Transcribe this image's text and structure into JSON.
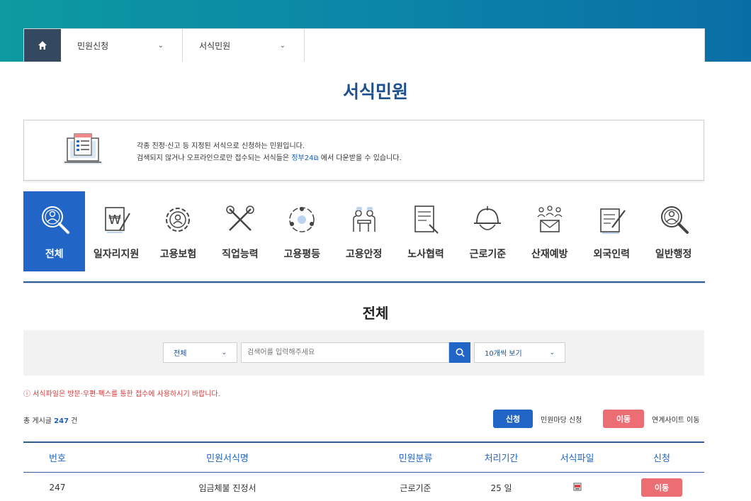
{
  "nav": {
    "home_icon": "home-icon",
    "menu1": "민원신청",
    "menu2": "서식민원"
  },
  "page_title": "서식민원",
  "info": {
    "line1": "각종 진정·신고 등 지정된 서식으로 신청하는 민원입니다.",
    "line2_pre": "검색되지 않거나 오프라인으로만 접수되는 서식들은",
    "line2_link": "정부24",
    "line2_post": "에서 다운받을 수 있습니다."
  },
  "categories": [
    {
      "label": "전체",
      "icon": "magnifier-person-icon",
      "active": true
    },
    {
      "label": "일자리지원",
      "icon": "won-document-icon"
    },
    {
      "label": "고용보험",
      "icon": "gear-person-icon"
    },
    {
      "label": "직업능력",
      "icon": "tools-icon"
    },
    {
      "label": "고용평등",
      "icon": "people-circle-icon"
    },
    {
      "label": "고용안정",
      "icon": "meeting-icon"
    },
    {
      "label": "노사협력",
      "icon": "document-person-icon"
    },
    {
      "label": "근로기준",
      "icon": "helmet-icon"
    },
    {
      "label": "산재예방",
      "icon": "mail-people-icon"
    },
    {
      "label": "외국인력",
      "icon": "document-pen-icon"
    },
    {
      "label": "일반행정",
      "icon": "magnifier-person-icon"
    }
  ],
  "section_title": "전체",
  "search": {
    "category_value": "전체",
    "placeholder": "검색어를 입력해주세요",
    "count_value": "10개씩 보기"
  },
  "notice": "ⓘ 서식파일은 방문·우편·팩스를 통한 접수에 사용하시기 바랍니다.",
  "total": {
    "prefix": "총 게시글",
    "count": "247",
    "suffix": "건"
  },
  "legend": {
    "apply_badge": "신청",
    "apply_text": "민원마당 신청",
    "move_badge": "이동",
    "move_text": "연계사이트 이동"
  },
  "table": {
    "headers": [
      "번호",
      "민원서식명",
      "민원분류",
      "처리기간",
      "서식파일",
      "신청"
    ],
    "rows": [
      {
        "no": "247",
        "name": "임금체불 진정서",
        "category": "근로기준",
        "period": "25 일",
        "file_icon": "document-file-icon",
        "action": "이동"
      }
    ]
  },
  "colors": {
    "accent": "#2166c6",
    "nav_home": "#344860",
    "red": "#ec6d74",
    "title": "#1e4f8e"
  }
}
